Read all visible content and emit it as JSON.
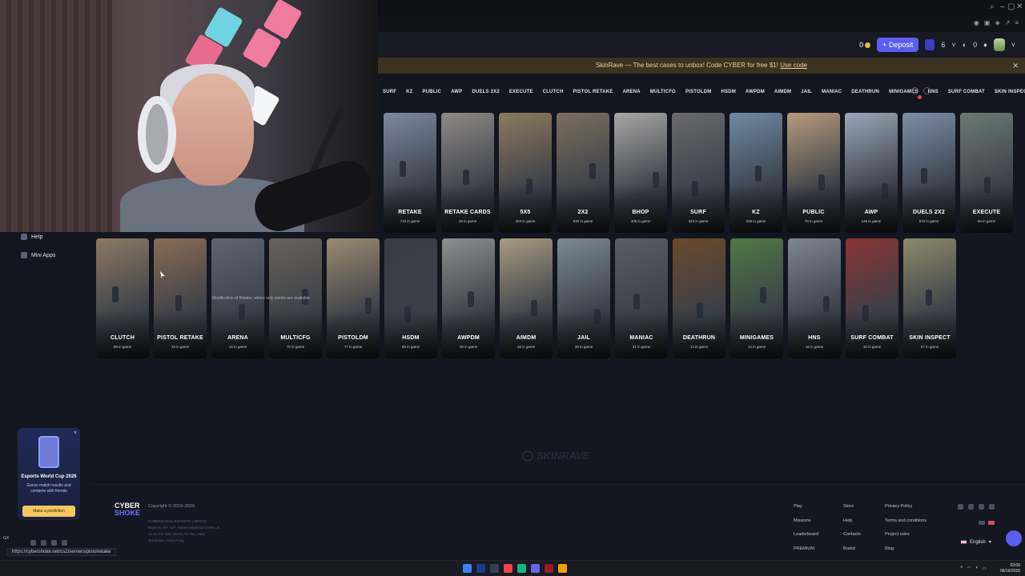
{
  "promo_banner": {
    "text": "SkinRave — The best cases to unbox! Code CYBER for free $1!",
    "link": "Use code",
    "close": "✕"
  },
  "header": {
    "balance": "0",
    "deposit_label": "+ Deposit",
    "chip_count": "6",
    "coin_count": "0"
  },
  "mode_tabs": [
    "SURF",
    "KZ",
    "PUBLIC",
    "AWP",
    "DUELS 2X2",
    "EXECUTE",
    "CLUTCH",
    "PISTOL RETAKE",
    "ARENA",
    "MULTICFG",
    "PISTOLDM",
    "HSDM",
    "AWPDM",
    "AIMDM",
    "JAIL",
    "MANIAC",
    "DEATHRUN",
    "MINIGAMES",
    "HNS",
    "SURF COMBAT",
    "SKIN INSPECT"
  ],
  "sidebar": {
    "items": [
      {
        "label": "Help",
        "icon": "help-icon"
      },
      {
        "label": "Mini Apps",
        "icon": "apps-icon"
      }
    ]
  },
  "promo_card": {
    "close": "×",
    "title": "Esports World Cup 2026",
    "text": "Guess match results and compete with friends",
    "button": "Make a prediction"
  },
  "cards_row1": [
    {
      "title": "RETAKE",
      "sub": "710 in game",
      "color": "#7a8aa0"
    },
    {
      "title": "RETAKE CARDS",
      "sub": "29 in game",
      "color": "#8f8a86"
    },
    {
      "title": "5X5",
      "sub": "404 in game",
      "color": "#8e7a5e"
    },
    {
      "title": "2X2",
      "sub": "530 in game",
      "color": "#7b6f5d"
    },
    {
      "title": "BHOP",
      "sub": "405 in game",
      "color": "#a9a7a5"
    },
    {
      "title": "SURF",
      "sub": "323 in game",
      "color": "#6a6a6e"
    },
    {
      "title": "KZ",
      "sub": "530 in game",
      "color": "#6f8aa5"
    },
    {
      "title": "PUBLIC",
      "sub": "70 in game",
      "color": "#b59c7a"
    },
    {
      "title": "AWP",
      "sub": "146 in game",
      "color": "#9aa6b8"
    },
    {
      "title": "DUELS 2X2",
      "sub": "572 in game",
      "color": "#7b8ea8"
    },
    {
      "title": "EXECUTE",
      "sub": "56 in game",
      "color": "#6b7a73"
    }
  ],
  "cards_row2": [
    {
      "title": "CLUTCH",
      "sub": "89 in game",
      "color": "#8d7963"
    },
    {
      "title": "PISTOL RETAKE",
      "sub": "32 in game",
      "color": "#8a6b54"
    },
    {
      "title": "ARENA",
      "sub": "16 in game",
      "color": "#5f6670"
    },
    {
      "title": "MULTICFG",
      "sub": "76 in game",
      "color": "#6a6258"
    },
    {
      "title": "PISTOLDM",
      "sub": "77 in game",
      "color": "#9c8a70"
    },
    {
      "title": "HSDM",
      "sub": "65 in game",
      "color": "#3a3d43"
    },
    {
      "title": "AWPDM",
      "sub": "48 in game",
      "color": "#8a8f8e"
    },
    {
      "title": "AIMDM",
      "sub": "18 in game",
      "color": "#a89b80"
    },
    {
      "title": "JAIL",
      "sub": "28 in game",
      "color": "#7b8a90"
    },
    {
      "title": "MANIAC",
      "sub": "31 in game",
      "color": "#595e63"
    },
    {
      "title": "DEATHRUN",
      "sub": "14 in game",
      "color": "#6b4a2a"
    },
    {
      "title": "MINIGAMES",
      "sub": "14 in game",
      "color": "#4f7a44"
    },
    {
      "title": "HNS",
      "sub": "16 in game",
      "color": "#7e8690"
    },
    {
      "title": "SURF COMBAT",
      "sub": "10 in game",
      "color": "#8a3434"
    },
    {
      "title": "SKIN INSPECT",
      "sub": "67 in game",
      "color": "#8c8a6a"
    }
  ],
  "tooltip": "Modification of Retake, where only pistols are available",
  "watermark": "SKINRAVE",
  "footer": {
    "logo_line1": "CYBER",
    "logo_line2": "SHOKE",
    "copyright": "Copyright © 2019–2026",
    "company": "CYBERSHOKE ESPORTS LIMITED",
    "company_address": "Room 8, 5/F, G/F, Yuba9 Industrial Centre, 2-12 Au Pui Wan Street, Fo Tan, New Territories, Hong Kong",
    "col1": [
      "Play",
      "Missions",
      "Leaderboard",
      "PREMIUM"
    ],
    "col2": [
      "Store",
      "Help",
      "Contacts",
      "Brand"
    ],
    "col3": [
      "Privacy Policy",
      "Terms and conditions",
      "Project rules",
      "Blog"
    ],
    "language": "English"
  },
  "status_url": "https://cybershoke.net/cs2/servers/pistolretake",
  "gx_label": "GX",
  "clock": {
    "time": "03:06",
    "date": "06/16/2026"
  }
}
